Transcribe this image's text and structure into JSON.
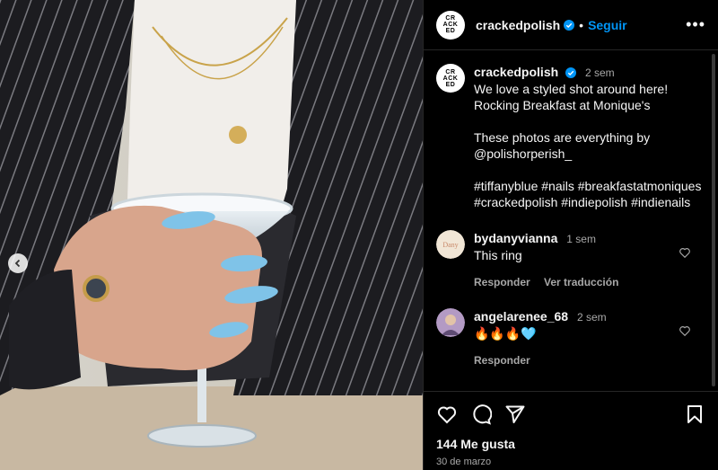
{
  "post": {
    "username": "crackedpolish",
    "follow_label": "Seguir",
    "more_label": "•••",
    "avatar_text": [
      "CR",
      "ACK",
      "ED"
    ]
  },
  "caption": {
    "username": "crackedpolish",
    "time": "2 sem",
    "text": "We love a styled shot around here! Rocking Breakfast at Monique's\n\nThese photos are everything by @polishorperish_\n\n#tiffanyblue #nails #breakfastatmoniques #crackedpolish #indiepolish #indienails"
  },
  "comments": [
    {
      "username": "bydanyvianna",
      "time": "1 sem",
      "text": "This ring",
      "reply_label": "Responder",
      "translate_label": "Ver traducción"
    },
    {
      "username": "angelarenee_68",
      "time": "2 sem",
      "text": "🔥🔥🔥🩵",
      "reply_label": "Responder"
    }
  ],
  "footer": {
    "likes": "144 Me gusta",
    "date": "30 de marzo"
  },
  "colors": {
    "accent": "#0095f6",
    "verified": "#0095f6",
    "muted": "#a8a8a8",
    "nail": "#7fc3e8"
  },
  "icons": [
    "chevron-left-icon",
    "verified-icon",
    "more-icon",
    "heart-icon",
    "comment-icon",
    "share-icon",
    "bookmark-icon"
  ]
}
